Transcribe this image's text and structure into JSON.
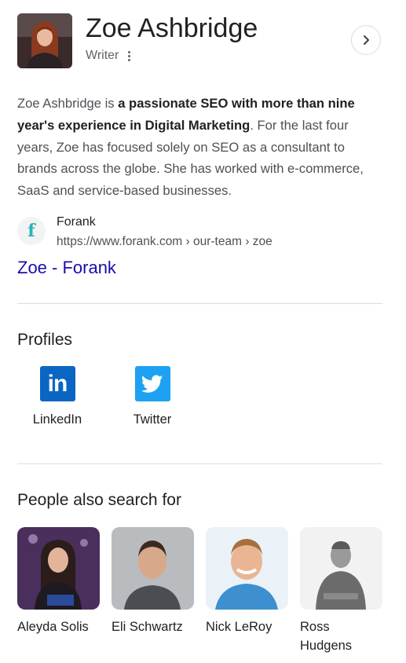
{
  "header": {
    "name": "Zoe Ashbridge",
    "role": "Writer",
    "more_icon": "more-vert-icon",
    "next_icon": "chevron-right-icon"
  },
  "description": {
    "part1": "Zoe Ashbridge is ",
    "bold": "a passionate SEO with more than nine year's experience in Digital Marketing",
    "part2": ". For the last four years, Zoe has focused solely on SEO as a consultant to brands across the globe. She has worked with e-commerce, SaaS and service-based businesses."
  },
  "source": {
    "favicon_letter": "f",
    "site_name": "Forank",
    "url": "https://www.forank.com › our-team › zoe",
    "link_title": "Zoe - Forank"
  },
  "profiles": {
    "title": "Profiles",
    "items": [
      {
        "label": "LinkedIn",
        "icon": "linkedin-icon",
        "color": "#0a66c2",
        "logo_text": "in"
      },
      {
        "label": "Twitter",
        "icon": "twitter-icon",
        "color": "#1da1f2"
      }
    ]
  },
  "people": {
    "title": "People also search for",
    "items": [
      {
        "name": "Aleyda Solis"
      },
      {
        "name": "Eli Schwartz"
      },
      {
        "name": "Nick LeRoy"
      },
      {
        "name": "Ross Hudgens"
      }
    ]
  },
  "colors": {
    "link": "#1a0dab",
    "text": "#202124",
    "secondary": "#5f6368",
    "divider": "#dadce0"
  }
}
